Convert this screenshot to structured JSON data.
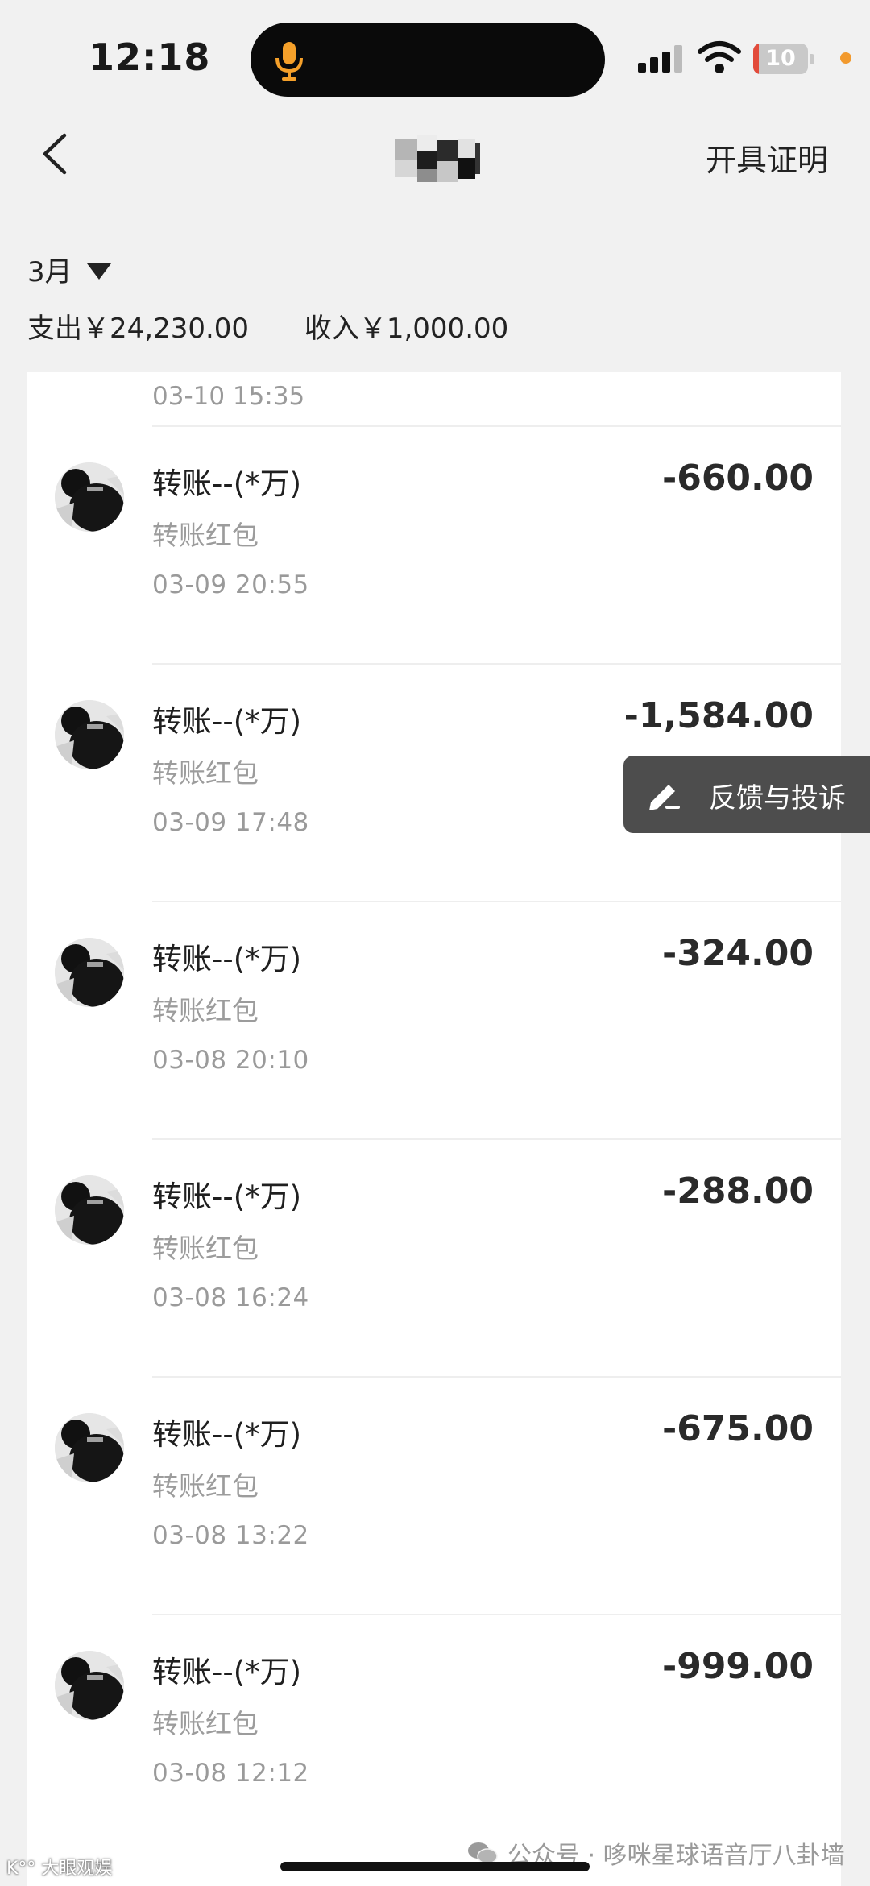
{
  "status": {
    "time": "12:18",
    "battery": {
      "label": "10",
      "level": 0.1,
      "color": "#e24b3b"
    },
    "privacy_dot_color": "#f29a2e",
    "mic_color": "#f5a02a"
  },
  "nav": {
    "back_icon": "chevron-left-icon",
    "title_redacted": true,
    "right_action": "开具证明"
  },
  "summary": {
    "month": "3月",
    "expense": "支出￥24,230.00",
    "income": "收入￥1,000.00"
  },
  "list": {
    "top_partial_time": "03-10 15:35",
    "items": [
      {
        "title": "转账--(*万)",
        "subtitle": "转账红包",
        "time": "03-09 20:55",
        "amount": "-660.00"
      },
      {
        "title": "转账--(*万)",
        "subtitle": "转账红包",
        "time": "03-09 17:48",
        "amount": "-1,584.00"
      },
      {
        "title": "转账--(*万)",
        "subtitle": "转账红包",
        "time": "03-08 20:10",
        "amount": "-324.00"
      },
      {
        "title": "转账--(*万)",
        "subtitle": "转账红包",
        "time": "03-08 16:24",
        "amount": "-288.00"
      },
      {
        "title": "转账--(*万)",
        "subtitle": "转账红包",
        "time": "03-08 13:22",
        "amount": "-675.00"
      },
      {
        "title": "转账--(*万)",
        "subtitle": "转账红包",
        "time": "03-08 12:12",
        "amount": "-999.00"
      }
    ]
  },
  "feedback": {
    "label": "反馈与投诉",
    "icon": "edit-icon"
  },
  "watermarks": {
    "left": "K°° 大眼观娱",
    "right": "公众号 · 哆咪星球语音厅八卦墙",
    "right_icon": "wechat-icon"
  }
}
